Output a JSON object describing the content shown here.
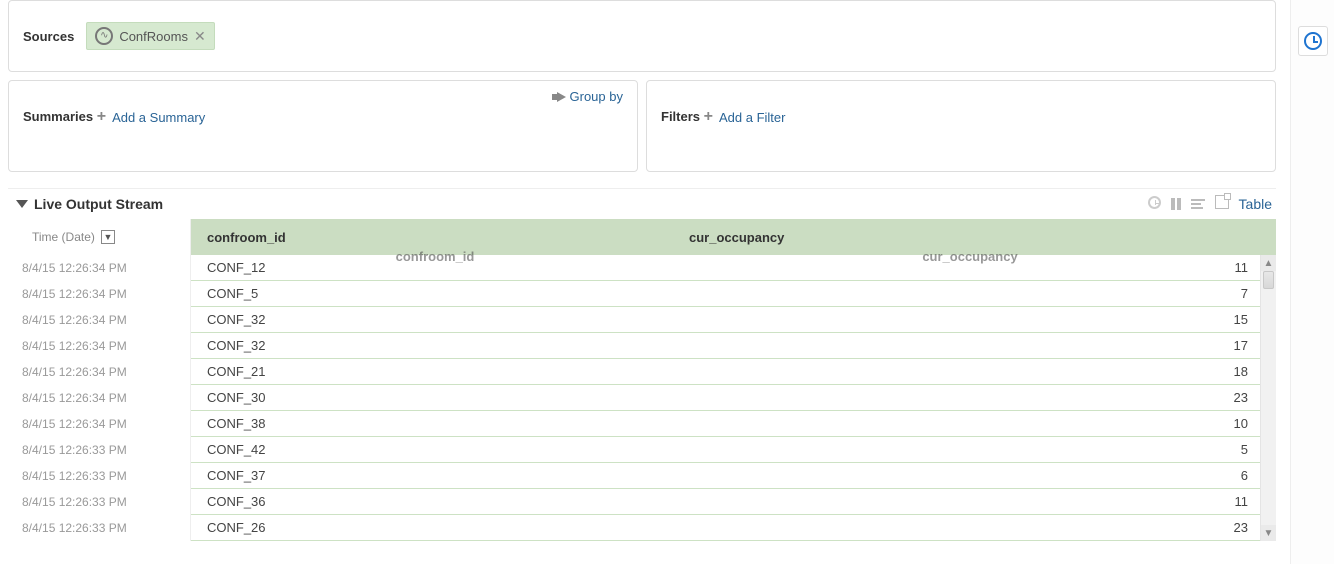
{
  "sources": {
    "title": "Sources",
    "chip": {
      "label": "ConfRooms"
    }
  },
  "summaries": {
    "title": "Summaries",
    "groupby_label": "Group by",
    "add_label": "Add a Summary"
  },
  "filters": {
    "title": "Filters",
    "add_label": "Add a Filter"
  },
  "live": {
    "title": "Live Output Stream",
    "time_header": "Time (Date)",
    "view_label": "Table",
    "columns": {
      "c1": "confroom_id",
      "c2": "cur_occupancy"
    },
    "ghost": {
      "c1": "confroom_id",
      "c2": "cur_occupancy"
    },
    "rows": [
      {
        "time": "8/4/15 12:26:34 PM",
        "id": "CONF_12",
        "occ": "11"
      },
      {
        "time": "8/4/15 12:26:34 PM",
        "id": "CONF_5",
        "occ": "7"
      },
      {
        "time": "8/4/15 12:26:34 PM",
        "id": "CONF_32",
        "occ": "15"
      },
      {
        "time": "8/4/15 12:26:34 PM",
        "id": "CONF_32",
        "occ": "17"
      },
      {
        "time": "8/4/15 12:26:34 PM",
        "id": "CONF_21",
        "occ": "18"
      },
      {
        "time": "8/4/15 12:26:34 PM",
        "id": "CONF_30",
        "occ": "23"
      },
      {
        "time": "8/4/15 12:26:34 PM",
        "id": "CONF_38",
        "occ": "10"
      },
      {
        "time": "8/4/15 12:26:33 PM",
        "id": "CONF_42",
        "occ": "5"
      },
      {
        "time": "8/4/15 12:26:33 PM",
        "id": "CONF_37",
        "occ": "6"
      },
      {
        "time": "8/4/15 12:26:33 PM",
        "id": "CONF_36",
        "occ": "11"
      },
      {
        "time": "8/4/15 12:26:33 PM",
        "id": "CONF_26",
        "occ": "23"
      }
    ]
  }
}
